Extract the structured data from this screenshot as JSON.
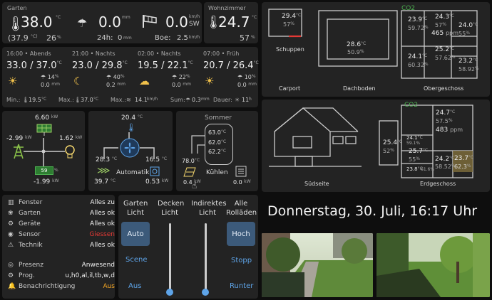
{
  "garten": {
    "title": "Garten",
    "temp": "38.0",
    "temp_unit": "°C",
    "temp_sub": "(37.9",
    "temp_sub_unit": "°C)",
    "humidity": "26",
    "humidity_unit": "%",
    "rain": "0.0",
    "rain_unit": "mm",
    "rain24_label": "24h:",
    "rain24": "0",
    "rain24_unit": "mm",
    "wind": "0.0",
    "wind_unit": "km/h",
    "wind_dir": "SW",
    "gust_label": "Boe:",
    "gust": "2.5",
    "gust_unit": "km/h"
  },
  "wohnzimmer": {
    "title": "Wohnzimmer",
    "temp": "24.7",
    "temp_unit": "°C",
    "humidity": "57",
    "humidity_unit": "%"
  },
  "forecast": {
    "slots": [
      {
        "time": "16:00 • Abends",
        "range": "33.0 / 37.0",
        "unit": "°C",
        "rain_pct": "14",
        "rain_mm": "0.0"
      },
      {
        "time": "21:00 • Nachts",
        "range": "23.0 / 29.8",
        "unit": "°C",
        "rain_pct": "40",
        "rain_mm": "0.2"
      },
      {
        "time": "02:00 • Nachts",
        "range": "19.5 / 22.1",
        "unit": "°C",
        "rain_pct": "22",
        "rain_mm": "0.0"
      },
      {
        "time": "07:00 • Früh",
        "range": "20.7 / 26.4",
        "unit": "°C",
        "rain_pct": "10",
        "rain_mm": "0.0"
      }
    ],
    "pct_unit": "%",
    "mm_unit": "mm",
    "min_label": "Min.:",
    "min_val": "19.5",
    "max_label": "Max.:",
    "max_val": "37.0",
    "maxwind_label": "Max.:",
    "maxwind_val": "14.1",
    "maxwind_unit": "km/h",
    "sum_label": "Sum:",
    "sum_val": "0.3",
    "sum_unit": "mm",
    "dauer_label": "Dauer:",
    "dauer_val": "11",
    "dauer_unit": "h"
  },
  "energy": {
    "solar": "6.60",
    "grid": "-2.99",
    "house": "1.62",
    "battery_pct": "59",
    "battery": "-1.99",
    "unit": "kW"
  },
  "ventilation": {
    "supply": "20.4",
    "outside": "28.3",
    "exhaust": "16.5",
    "inside": "39.7",
    "power": "0.53",
    "mode": "Automatik",
    "temp_unit": "°C",
    "power_unit": "kW"
  },
  "water": {
    "title": "Sommer",
    "t1": "63.0",
    "t2": "62.0",
    "t3": "62.2",
    "inlet": "78.0",
    "unit": "°C",
    "solar_power": "0.4",
    "heater_power": "0.0",
    "power_unit": "kW",
    "mode": "Kühlen"
  },
  "floorplan_top": {
    "co2_label": "CO2",
    "schuppen": {
      "temp": "29.4",
      "hum": "57"
    },
    "dachboden_room": {
      "temp": "28.6",
      "hum": "50.9"
    },
    "og_rooms": [
      {
        "temp": "23.9",
        "hum": "59.72"
      },
      {
        "temp": "24.3",
        "hum": "57"
      },
      {
        "temp": "24.0",
        "hum": "55"
      },
      {
        "temp": "24.1",
        "hum": "60.32"
      },
      {
        "temp": "25.2",
        "hum": "57.62"
      },
      {
        "temp": "23.2",
        "hum": "58.92"
      }
    ],
    "co2_value": "465",
    "ppm": "ppm",
    "labels": {
      "schuppen": "Schuppen",
      "carport": "Carport",
      "dachboden": "Dachboden",
      "og": "Obergeschoss"
    }
  },
  "floorplan_bottom": {
    "co2_label": "CO2",
    "suedseite": "Südseite",
    "eg": "Erdgeschoss",
    "rooms": [
      {
        "temp": "24.7",
        "hum": "57.5"
      },
      {
        "temp": "25.4",
        "hum": "52"
      },
      {
        "temp": "24.1",
        "hum": "59.1"
      },
      {
        "temp": "25.7",
        "hum": "55"
      },
      {
        "temp": "24.2",
        "hum": "58.52"
      },
      {
        "temp": "23.7",
        "hum": "62.3"
      },
      {
        "temp": "23.8",
        "hum": "61.6"
      }
    ],
    "co2_value": "483",
    "ppm": "ppm"
  },
  "status": {
    "rows": [
      {
        "key": "Fenster",
        "value": "Alles zu"
      },
      {
        "key": "Garten",
        "value": "Alles ok"
      },
      {
        "key": "Geräte",
        "value": "Alles ok"
      },
      {
        "key": "Sensor",
        "value": "Giessen"
      },
      {
        "key": "Technik",
        "value": "Alles ok"
      }
    ],
    "rows2": [
      {
        "key": "Presenz",
        "value": "Anwesend"
      },
      {
        "key": "Prog.",
        "value": "u,h0,al,il,tb,w,d"
      },
      {
        "key": "Benachrichtigung",
        "value": "Aus"
      }
    ],
    "colors": {
      "alert": "#e53935",
      "warn": "#f5a623"
    }
  },
  "controls": {
    "garten_licht": {
      "title": "Garten Licht",
      "btn": "Auto",
      "scene": "Scene",
      "aus": "Aus"
    },
    "decken_licht": {
      "title": "Decken Licht"
    },
    "indirektes_licht": {
      "title": "Indirektes Licht"
    },
    "rollaeden": {
      "title": "Alle Rolläden",
      "hoch": "Hoch",
      "stopp": "Stopp",
      "runter": "Runter"
    }
  },
  "datetime": "Donnerstag, 30. Juli, 16:17 Uhr"
}
